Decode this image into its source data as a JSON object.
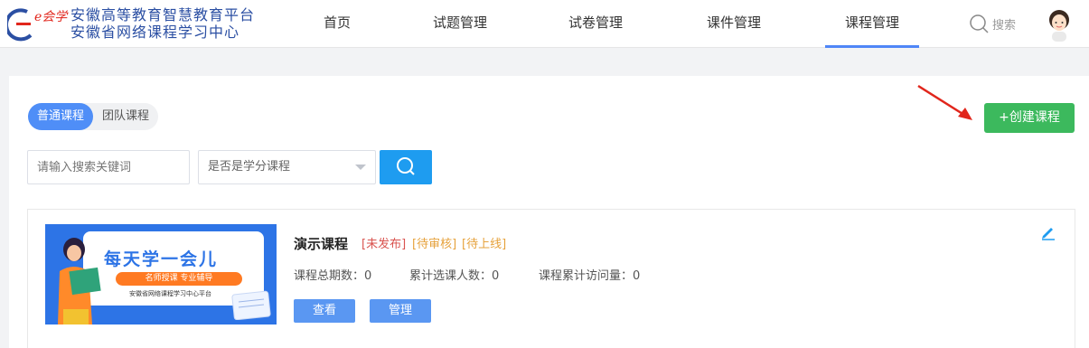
{
  "header": {
    "logo_mark_text": "e会学",
    "logo_line1": "安徽高等教育智慧教育平台",
    "logo_line2": "安徽省网络课程学习中心",
    "nav": [
      {
        "label": "首页"
      },
      {
        "label": "试题管理"
      },
      {
        "label": "试卷管理"
      },
      {
        "label": "课件管理"
      },
      {
        "label": "课程管理"
      }
    ],
    "active_nav": "课程管理",
    "search_label": "搜索"
  },
  "tabs": [
    {
      "label": "普通课程",
      "active": true
    },
    {
      "label": "团队课程",
      "active": false
    }
  ],
  "create_button": "+创建课程",
  "filters": {
    "keyword_placeholder": "请输入搜索关键词",
    "credit_select": "是否是学分课程"
  },
  "course": {
    "thumbnail": {
      "title": "每天学一会儿",
      "pill": "名师授课 专业辅导",
      "subtitle": "安徽省网络课程学习中心平台"
    },
    "name": "演示课程",
    "tags": [
      "[未发布]",
      "[待审核]",
      "[待上线]"
    ],
    "stats": [
      "课程总期数：0",
      "累计选课人数：0",
      "课程累计访问量：0"
    ],
    "view_button": "查看",
    "manage_button": "管理"
  },
  "colors": {
    "accent": "#4f8ef7",
    "create_green": "#3cb95d",
    "search_blue": "#1e9cf0",
    "tag_red": "#d9534f",
    "tag_orange": "#e6a23c"
  }
}
